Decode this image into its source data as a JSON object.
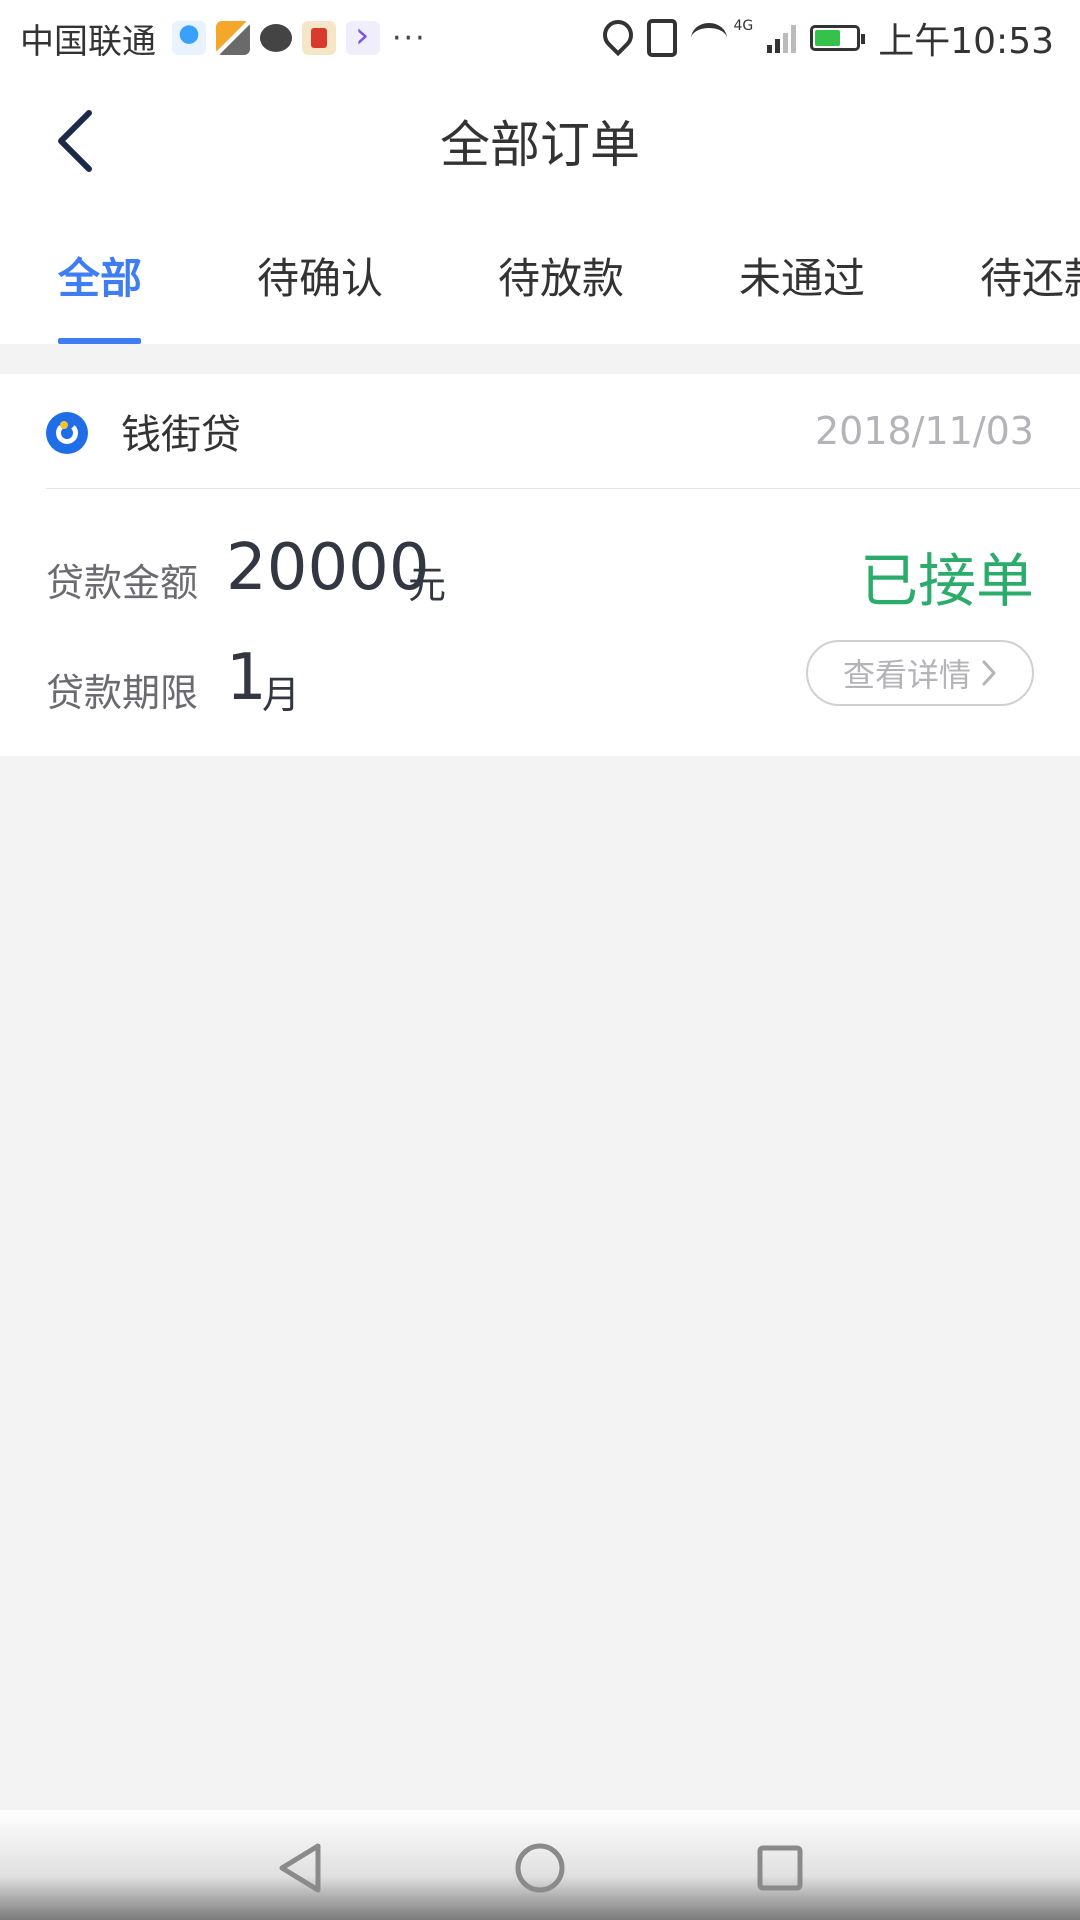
{
  "status_bar": {
    "carrier": "中国联通",
    "more": "···",
    "network": "4G",
    "time": "上午10:53",
    "battery_level": 0.62,
    "notification_icons": [
      "account-app-icon",
      "bolt-app-icon",
      "wechat-icon",
      "red-app-icon",
      "video-app-icon"
    ]
  },
  "header": {
    "title": "全部订单",
    "back_icon": "chevron-left-icon"
  },
  "tabs": [
    {
      "label": "全部",
      "active": true
    },
    {
      "label": "待确认",
      "active": false
    },
    {
      "label": "待放款",
      "active": false
    },
    {
      "label": "未通过",
      "active": false
    },
    {
      "label": "待还款",
      "active": false
    }
  ],
  "order": {
    "lender": "钱街贷",
    "date": "2018/11/03",
    "amount_label": "贷款金额",
    "amount": "20000",
    "amount_unit": "元",
    "term_label": "贷款期限",
    "term": "1",
    "term_unit": "月",
    "status": "已接单",
    "detail_button": "查看详情"
  },
  "colors": {
    "accent": "#3f7df3",
    "status_success": "#2bac6b",
    "back_icon": "#1c2a4a"
  },
  "nav_bar": {
    "icons": [
      "back-triangle-icon",
      "home-circle-icon",
      "recents-square-icon"
    ]
  }
}
